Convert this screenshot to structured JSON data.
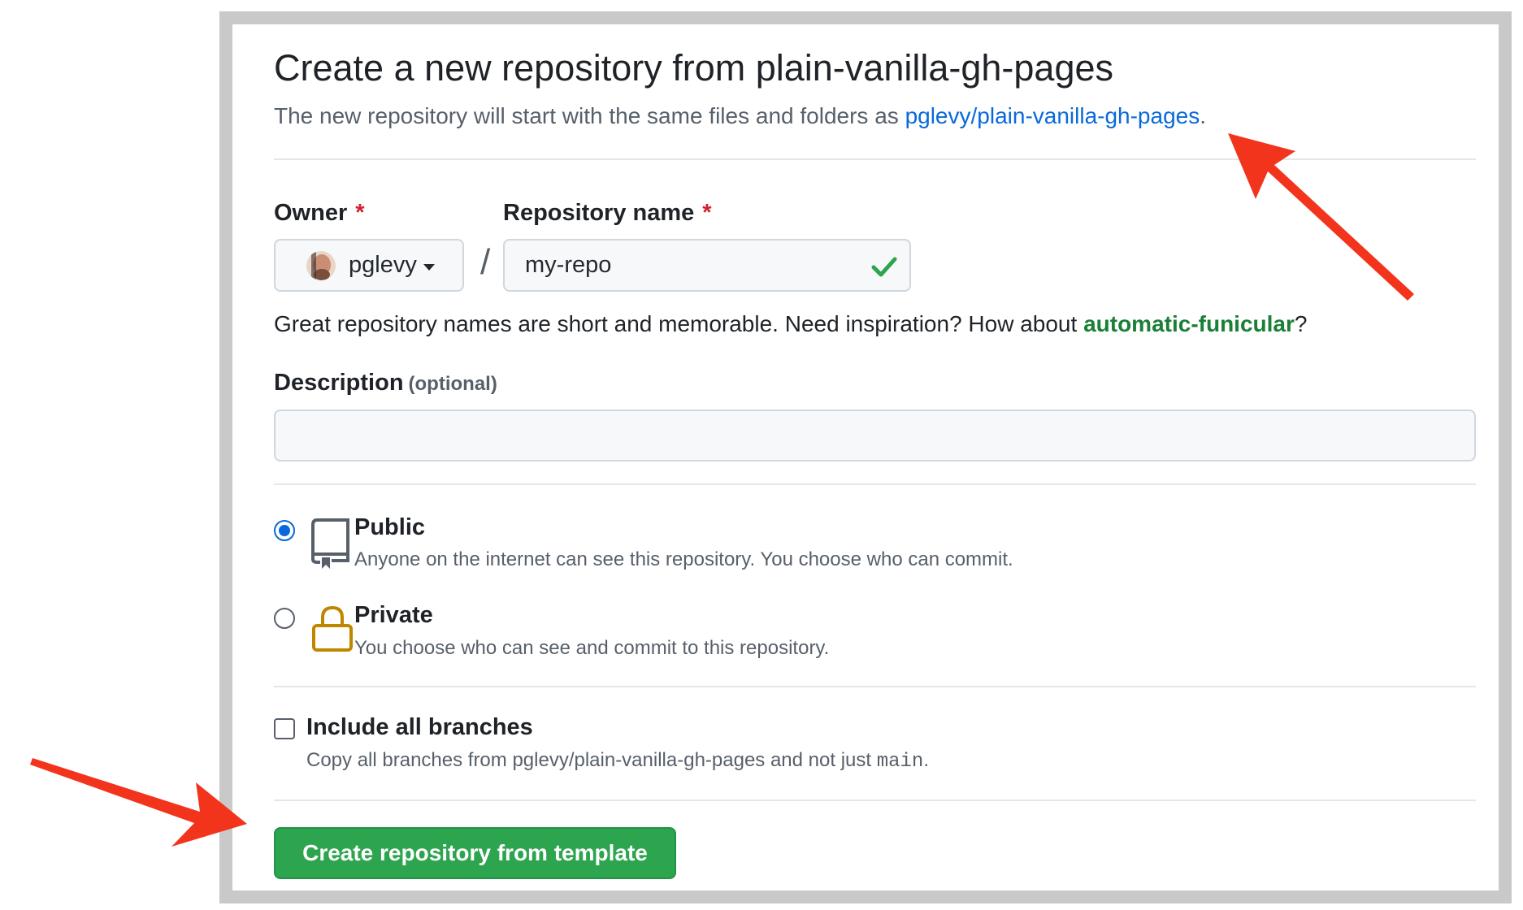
{
  "header": {
    "title": "Create a new repository from plain-vanilla-gh-pages",
    "subtitle_prefix": "The new repository will start with the same files and folders as ",
    "template_link": "pglevy/plain-vanilla-gh-pages",
    "subtitle_suffix": "."
  },
  "owner": {
    "label": "Owner",
    "required_mark": "*",
    "value": "pglevy"
  },
  "separator": "/",
  "repo_name": {
    "label": "Repository name",
    "required_mark": "*",
    "value": "my-repo",
    "valid": true
  },
  "hint": {
    "prefix": "Great repository names are short and memorable. Need inspiration? How about ",
    "suggestion": "automatic-funicular",
    "suffix": "?"
  },
  "description": {
    "label": "Description",
    "optional": "(optional)",
    "value": ""
  },
  "visibility": {
    "selected": "public",
    "public": {
      "title": "Public",
      "desc": "Anyone on the internet can see this repository. You choose who can commit."
    },
    "private": {
      "title": "Private",
      "desc": "You choose who can see and commit to this repository."
    }
  },
  "branches": {
    "checked": false,
    "label": "Include all branches",
    "desc_prefix": "Copy all branches from pglevy/plain-vanilla-gh-pages and not just ",
    "desc_code": "main",
    "desc_suffix": "."
  },
  "submit": {
    "label": "Create repository from template"
  },
  "colors": {
    "link": "#0969da",
    "suggestion": "#1a7f37",
    "primary_button": "#2da44e",
    "annotation_arrow": "#f3341c",
    "private_icon": "#bf8700"
  }
}
